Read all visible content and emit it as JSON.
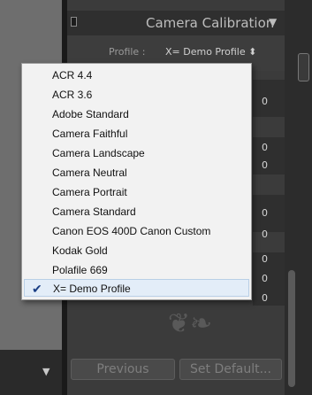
{
  "panel": {
    "title": "Camera Calibration",
    "profile_label": "Profile :",
    "profile_value": "X= Demo Profile ⬍"
  },
  "values": [
    "0",
    "0",
    "0",
    "0",
    "0",
    "0",
    "0",
    "0"
  ],
  "buttons": {
    "previous": "Previous",
    "set_default": "Set Default..."
  },
  "menu": {
    "items": [
      "ACR 4.4",
      "ACR 3.6",
      "Adobe Standard",
      "Camera Faithful",
      "Camera Landscape",
      "Camera Neutral",
      "Camera Portrait",
      "Camera Standard",
      "Canon EOS 400D Canon Custom",
      "Kodak Gold",
      "Polafile 669",
      "X= Demo Profile"
    ],
    "selected": "X= Demo Profile",
    "check_glyph": "✔"
  },
  "icons": {
    "panel_caret": "▼",
    "filmstrip_arrow": "▼",
    "ornament": "❦❧"
  }
}
